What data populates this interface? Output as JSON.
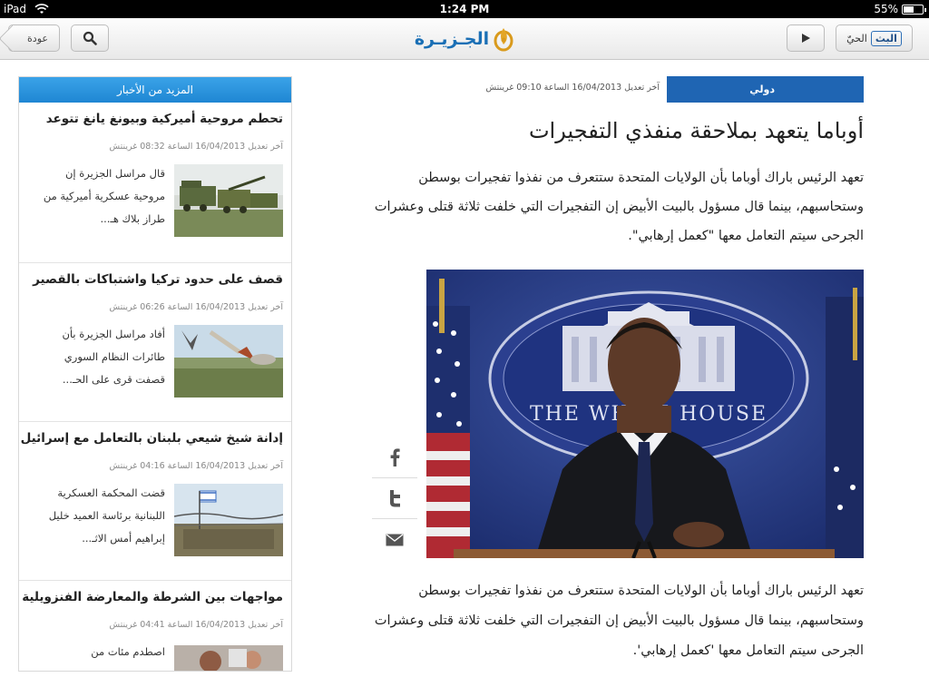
{
  "status_bar": {
    "carrier": "iPad",
    "time": "1:24 PM",
    "battery": "55%",
    "battery_level": 0.55
  },
  "toolbar": {
    "back_label": "عودة",
    "logo_text": "الجـزيـرة",
    "live_badge": "البث",
    "live_text": "الحيّ"
  },
  "sidebar": {
    "header": "المزيد من الأخبار",
    "stories": [
      {
        "title": "تحطم مروحية أميركية وبيونغ يانغ تتوعد",
        "time": "آخر تعديل 16/04/2013 الساعة 08:32 غرينتش",
        "summary": "قال مراسل الجزيرة إن مروحية عسكرية أميركية من طراز بلاك هـ..."
      },
      {
        "title": "قصف على حدود تركيا واشتباكات بالقصير",
        "time": "آخر تعديل 16/04/2013 الساعة 06:26 غرينتش",
        "summary": "أفاد مراسل الجزيرة بأن طائرات النظام السوري قصفت قرى على الحـ..."
      },
      {
        "title": "إدانة شيخ شيعي بلبنان بالتعامل مع إسرائيل",
        "time": "آخر تعديل 16/04/2013 الساعة 04:16 غرينتش",
        "summary": "قضت المحكمة العسكرية اللبنانية برئاسة العميد خليل إبراهيم أمس الاثـ..."
      },
      {
        "title": "مواجهات بين الشرطة والمعارضة الفنزويلية",
        "time": "آخر تعديل 16/04/2013 الساعة 04:41 غرينتش",
        "summary": "اصطدم مئات من"
      }
    ]
  },
  "article": {
    "section": "دولي",
    "updated": "آخر تعديل 16/04/2013 الساعة 09:10 غرينتش",
    "headline": "أوباما يتعهد بملاحقة منفذي التفجيرات",
    "lead": "تعهد الرئيس باراك أوباما بأن الولايات المتحدة ستتعرف من نفذوا تفجيرات بوسطن وستحاسبهم، بينما قال مسؤول بالبيت الأبيض إن التفجيرات التي خلفت ثلاثة قتلى وعشرات الجرحى سيتم التعامل معها \"كعمل إرهابي\".",
    "body": "تعهد الرئيس باراك أوباما بأن الولايات المتحدة ستتعرف من نفذوا تفجيرات بوسطن وستحاسبهم، بينما قال مسؤول بالبيت الأبيض إن التفجيرات التي خلفت ثلاثة قتلى وعشرات الجرحى سيتم التعامل معها 'كعمل إرهابي'.",
    "photo_sign": "THE WHITE HOUSE"
  },
  "share": [
    "facebook-icon",
    "twitter-icon",
    "email-icon"
  ],
  "colors": {
    "brand_blue": "#1f65b3",
    "sidebar_header": "#2a95de",
    "logo_gold": "#d99a1c"
  }
}
